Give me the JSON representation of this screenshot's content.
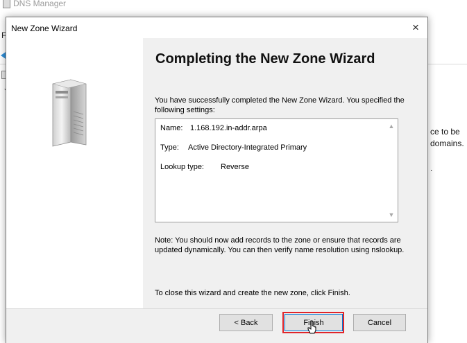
{
  "background": {
    "title": "DNS Manager",
    "menu_letter": "F",
    "text_lines": [
      "ce to be",
      "domains.",
      "."
    ]
  },
  "dialog": {
    "title": "New Zone Wizard",
    "close_glyph": "×",
    "heading": "Completing the New Zone Wizard",
    "intro": "You have successfully completed the New Zone Wizard. You specified the following settings:",
    "settings": [
      {
        "key": "Name:",
        "value": "1.168.192.in-addr.arpa"
      },
      {
        "key": "Type:",
        "value": "Active Directory-Integrated Primary"
      },
      {
        "key": "Lookup type:",
        "value": "Reverse"
      }
    ],
    "note": "Note: You should now add records to the zone or ensure that records are updated dynamically. You can then verify name resolution using nslookup.",
    "close_hint": "To close this wizard and create the new zone, click Finish.",
    "buttons": {
      "back": "< Back",
      "finish": "Finish",
      "cancel": "Cancel"
    }
  },
  "colors": {
    "highlight": "#e0252a",
    "accent": "#0078d7"
  }
}
